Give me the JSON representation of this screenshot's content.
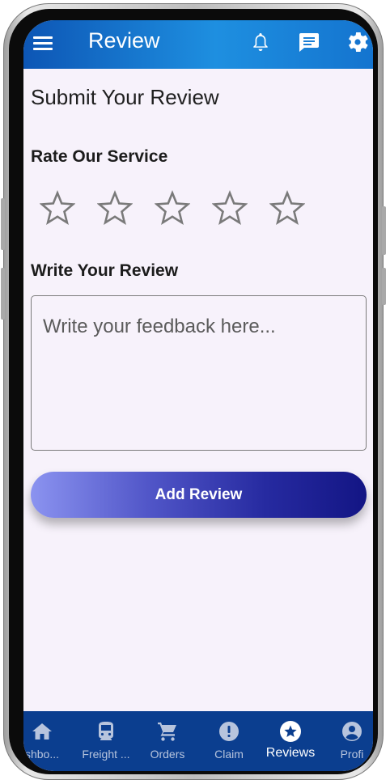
{
  "appbar": {
    "title": "Review",
    "icons": [
      "menu-icon",
      "bell-icon",
      "chat-icon",
      "gear-icon"
    ]
  },
  "main": {
    "heading": "Submit Your Review",
    "rating_label": "Rate Our Service",
    "rating": {
      "value": 0,
      "max": 5
    },
    "review_label": "Write Your Review",
    "review_placeholder": "Write your feedback here...",
    "review_value": "",
    "submit_label": "Add Review"
  },
  "bottom_nav": {
    "items": [
      {
        "label": "shbo...",
        "icon": "home-icon"
      },
      {
        "label": "Freight ...",
        "icon": "train-icon"
      },
      {
        "label": "Orders",
        "icon": "cart-icon"
      },
      {
        "label": "Claim",
        "icon": "alert-icon"
      },
      {
        "label": "Reviews",
        "icon": "star-badge-icon",
        "active": true
      },
      {
        "label": "Profi",
        "icon": "account-icon"
      }
    ]
  },
  "colors": {
    "appbar_start": "#0d56b5",
    "appbar_end": "#1e8fe0",
    "nav_background": "#0b3e8f",
    "button_start": "#8b93f0",
    "button_end": "#131584",
    "screen_background": "#f7f2fb"
  }
}
